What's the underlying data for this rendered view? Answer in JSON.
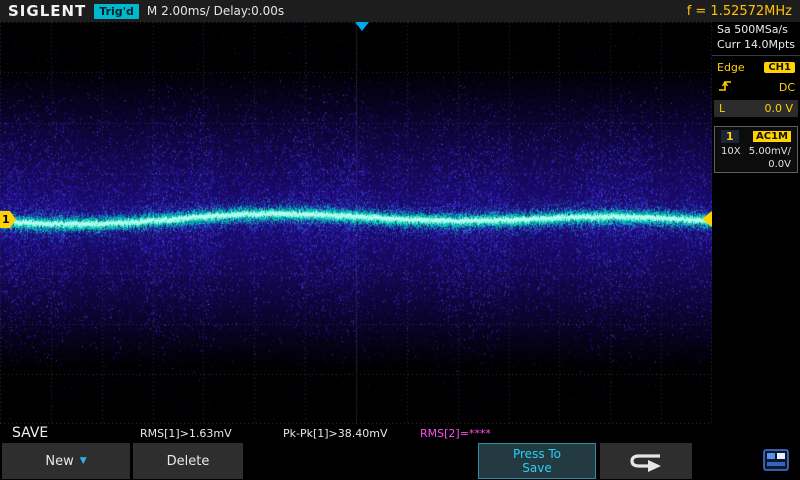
{
  "top_bar": {
    "brand": "SIGLENT",
    "trig_status": "Trig'd",
    "timebase": "M 2.00ms/ Delay:0.00s",
    "frequency": "f = 1.52572MHz"
  },
  "sidebar": {
    "sample_rate": "Sa 500MSa/s",
    "mem_depth": "Curr 14.0Mpts",
    "trigger": {
      "mode": "Edge",
      "source": "CH1",
      "coupling": "DC",
      "level_label": "L",
      "level_value": "0.0 V"
    },
    "channel": {
      "number": "1",
      "coupling": "AC1M",
      "probe": "10X",
      "scale": "5.00mV/",
      "offset": "0.0V"
    }
  },
  "wave_area": {
    "channel_marker": "1"
  },
  "status_row": {
    "page_label": "SAVE",
    "measurements": {
      "rms1": "RMS[1]>1.63mV",
      "pkpk1": "Pk-Pk[1]>38.40mV",
      "rms2": "RMS[2]=****"
    }
  },
  "menu": {
    "new_label": "New",
    "delete_label": "Delete",
    "save_line1": "Press To",
    "save_line2": "Save"
  },
  "icons": {
    "dropdown": "▼"
  },
  "waveform": {
    "grid": {
      "h_divs": 14,
      "v_divs": 8
    },
    "band": {
      "center_frac": 0.49,
      "core_spread": 7,
      "glow_spread": 16,
      "mid_spread": 105,
      "outer_spread": 185,
      "full_spread": 195,
      "fill_half": 150
    },
    "colors": {
      "grid": "#2e2e2e",
      "axis": "#3e3e3e",
      "band_fill_rgb": "54,22,230",
      "mid_dots": [
        "#5040ff",
        "#3a22e8",
        "#6a55ff",
        "#2f14d8"
      ],
      "outer_dot": "#2a10c0",
      "sparse_dot": "#22089e",
      "core_glow": "#20a8ff",
      "core_main": "#00e8b8",
      "core_bright": "#b8ffee"
    }
  }
}
